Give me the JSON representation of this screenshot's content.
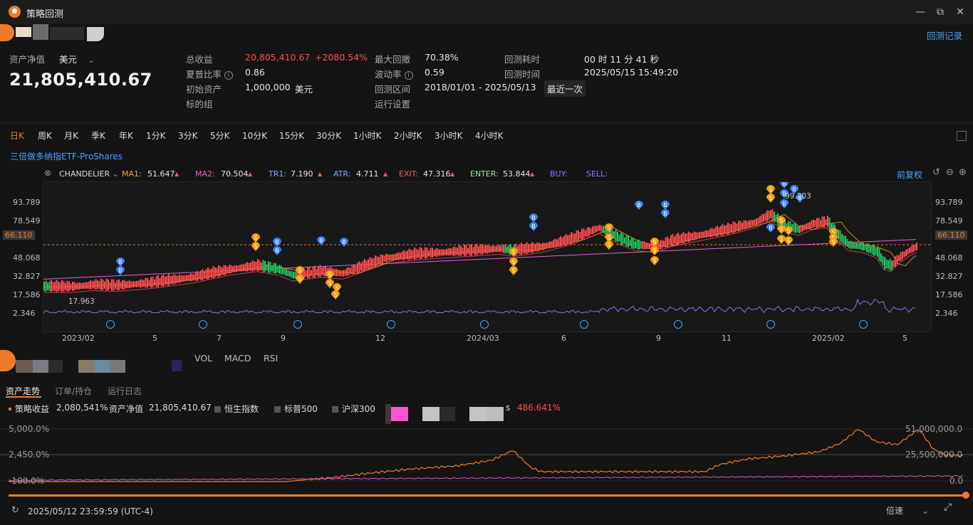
{
  "app": {
    "title": "策略回测"
  },
  "window_controls": {
    "minimize": "—",
    "restore": "⧉",
    "close": "✕"
  },
  "header": {
    "history_link": "回测记录"
  },
  "summary": {
    "nav_label": "资产净值",
    "currency": "美元",
    "nav_value": "21,805,410.67",
    "total_return_label": "总收益",
    "total_return_value": "20,805,410.67",
    "total_return_pct": "+2080.54%",
    "sharpe_label": "夏普比率",
    "sharpe_value": "0.86",
    "initial_label": "初始资产",
    "initial_value": "1,000,000",
    "initial_currency": "美元",
    "target_label": "标的组",
    "max_dd_label": "最大回撤",
    "max_dd_value": "70.38%",
    "vol_label": "波动率",
    "vol_value": "0.59",
    "range_label": "回测区间",
    "range_value": "2018/01/01 - 2025/05/13",
    "latest_btn": "最近一次",
    "settings_label": "运行设置",
    "elapsed_label": "回测耗时",
    "elapsed_value": "00 时 11 分 41 秒",
    "bt_time_label": "回测时间",
    "bt_time_value": "2025/05/15 15:49:20"
  },
  "periods": [
    "日K",
    "周K",
    "月K",
    "季K",
    "年K",
    "1分K",
    "3分K",
    "5分K",
    "10分K",
    "15分K",
    "30分K",
    "1小时K",
    "2小时K",
    "3小时K",
    "4小时K"
  ],
  "instrument": "三倍做多纳指ETF-ProShares",
  "indicators": {
    "name": "CHANDELIER",
    "items": [
      {
        "label": "MA1:",
        "value": "51.647",
        "color": "#f5a623"
      },
      {
        "label": "MA2:",
        "value": "70.504",
        "color": "#e05fd0"
      },
      {
        "label": "TR1:",
        "value": "7.190",
        "color": "#8aa6ff"
      },
      {
        "label": "ATR:",
        "value": "4.711",
        "color": "#8aa6ff"
      },
      {
        "label": "EXIT:",
        "value": "47.316",
        "color": "#ff5a5a"
      },
      {
        "label": "ENTER:",
        "value": "53.844",
        "color": "#9be3a6"
      },
      {
        "label": "BUY:",
        "value": "",
        "color": "#8c7bff"
      },
      {
        "label": "SELL:",
        "value": "",
        "color": "#8c7bff"
      }
    ],
    "adjust_label": "前复权"
  },
  "chart_axis": {
    "y_ticks": [
      "93.789",
      "78.549",
      "66.110",
      "48.068",
      "32.827",
      "17.586",
      "2.346"
    ],
    "current_price": "66.110",
    "low_label": "17.963",
    "high_label": "99.203",
    "x_ticks": [
      "2023/02",
      "5",
      "7",
      "9",
      "12",
      "2024/03",
      "6",
      "9",
      "11",
      "2025/02",
      "5"
    ]
  },
  "subcharts": [
    "VOL",
    "MACD",
    "RSI"
  ],
  "tabs": [
    "资产走势",
    "订单/持仓",
    "运行日志"
  ],
  "legend": [
    {
      "label": "策略收益",
      "value": "2,080,541%",
      "color": "#f07a2a"
    },
    {
      "label": "资产净值",
      "value": "21,805,410.67",
      "color": ""
    },
    {
      "label": "恒生指数",
      "value": "",
      "color": "#555555"
    },
    {
      "label": "标普500",
      "value": "",
      "color": "#555555"
    },
    {
      "label": "沪深300",
      "value": "",
      "color": "#555555"
    }
  ],
  "legend_extra_value": "486.641%",
  "equity_axis": {
    "left": [
      "5,000.0%",
      "2,450.0%",
      "-100.0%"
    ],
    "right": [
      "51,000,000.0",
      "25,500,000.0",
      "0.0"
    ]
  },
  "footer": {
    "timestamp": "2025/05/12 23:59:59 (UTC-4)",
    "speed_label": "倍速"
  },
  "colors": {
    "accent": "#f07a2a",
    "up": "#ff4d4f",
    "down": "#22c55e"
  }
}
